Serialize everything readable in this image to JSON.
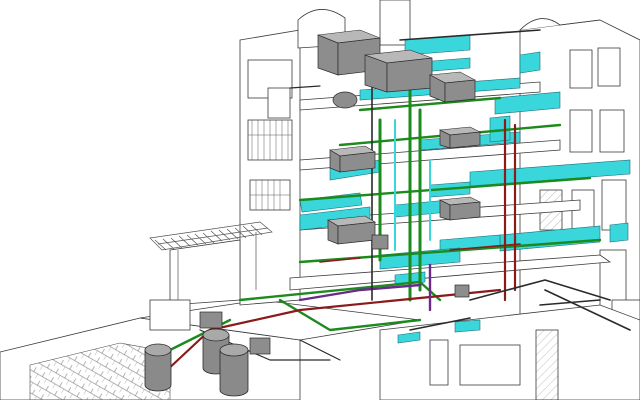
{
  "diagram": {
    "colors": {
      "background": "#ffffff",
      "building_outline": "#3a3a3a",
      "duct": "#39d6dc",
      "duct_edge": "#1e6f78",
      "green_pipe": "#1c8a1c",
      "red_pipe": "#8b1a1a",
      "purple_pipe": "#6a2a8a",
      "dark_pipe": "#2a2a2a",
      "equipment": "#8d8d8d",
      "tank": "#8a8a8a"
    },
    "icons": [
      "hvac-unit",
      "storage-tank",
      "duct-network",
      "pipe-network"
    ]
  }
}
